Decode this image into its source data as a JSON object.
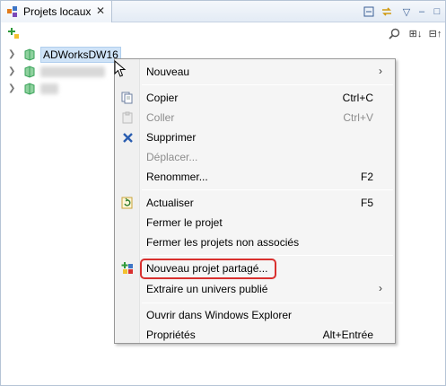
{
  "tab": {
    "title": "Projets locaux",
    "close_glyph": "✕"
  },
  "view_toolbar": {
    "minimize_glyph": "▭",
    "sync_glyph": "⇆",
    "menu_glyph": "▽",
    "minimize2_glyph": "–",
    "maximize_glyph": "□"
  },
  "toolbar": {
    "new_project_glyph": "✚",
    "search_glyph": "🔍",
    "expand_glyph": "⊞↓",
    "collapse_glyph": "⊟↑"
  },
  "tree": {
    "items": [
      {
        "label": "ADWorksDW16",
        "selected": true
      },
      {
        "label": "",
        "selected": false
      },
      {
        "label": "",
        "selected": false
      }
    ]
  },
  "context_menu": {
    "items": [
      {
        "label": "Nouveau",
        "shortcut": "",
        "submenu": true,
        "disabled": false
      },
      {
        "label": "Copier",
        "shortcut": "Ctrl+C",
        "submenu": false,
        "disabled": false
      },
      {
        "label": "Coller",
        "shortcut": "Ctrl+V",
        "submenu": false,
        "disabled": true
      },
      {
        "label": "Supprimer",
        "shortcut": "",
        "submenu": false,
        "disabled": false
      },
      {
        "label": "Déplacer...",
        "shortcut": "",
        "submenu": false,
        "disabled": true
      },
      {
        "label": "Renommer...",
        "shortcut": "F2",
        "submenu": false,
        "disabled": false
      },
      {
        "label": "Actualiser",
        "shortcut": "F5",
        "submenu": false,
        "disabled": false
      },
      {
        "label": "Fermer le projet",
        "shortcut": "",
        "submenu": false,
        "disabled": false
      },
      {
        "label": "Fermer les projets non associés",
        "shortcut": "",
        "submenu": false,
        "disabled": false
      },
      {
        "label": "Nouveau projet partagé...",
        "shortcut": "",
        "submenu": false,
        "disabled": false,
        "highlighted": true
      },
      {
        "label": "Extraire un univers publié",
        "shortcut": "",
        "submenu": true,
        "disabled": false
      },
      {
        "label": "Ouvrir dans Windows Explorer",
        "shortcut": "",
        "submenu": false,
        "disabled": false
      },
      {
        "label": "Propriétés",
        "shortcut": "Alt+Entrée",
        "submenu": false,
        "disabled": false
      }
    ],
    "submenu_arrow": "›",
    "highlight_color": "#d9302e"
  },
  "colors": {
    "selection_bg": "#cfe3f7",
    "project_icon": "#3aa35a",
    "delete_icon": "#2a5db0"
  }
}
